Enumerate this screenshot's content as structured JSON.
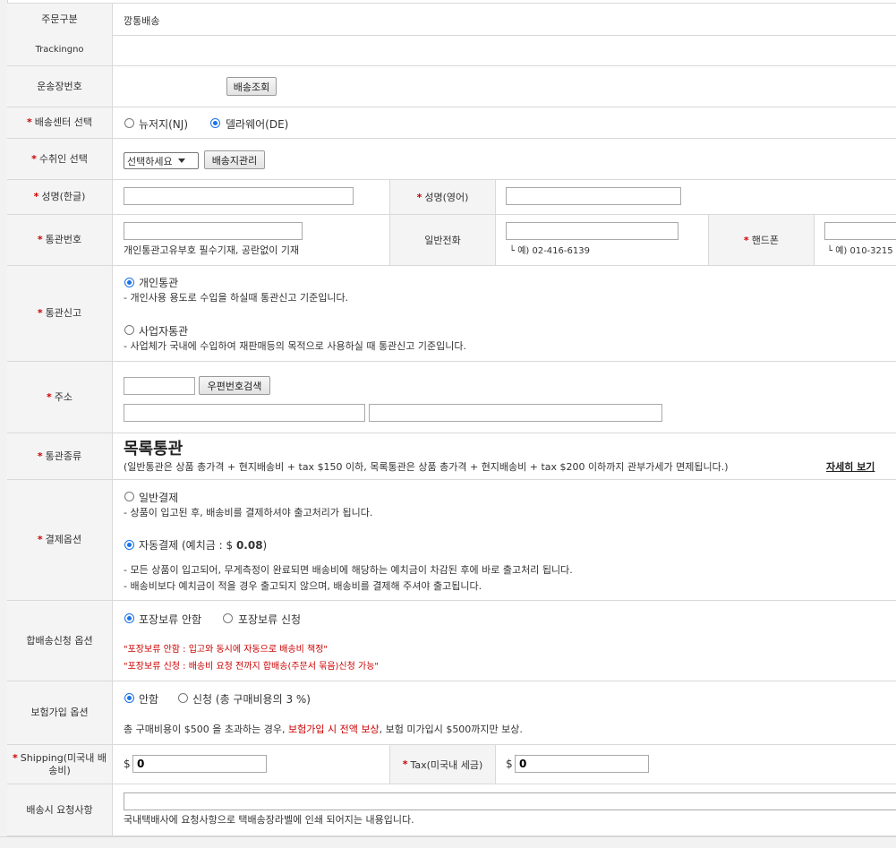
{
  "order_type": {
    "label": "주문구분",
    "value": "깡통배송"
  },
  "tracking": {
    "label": "Trackingno"
  },
  "waybill": {
    "label": "운송장번호",
    "button": "배송조회"
  },
  "center": {
    "label": "배송센터 선택",
    "options": [
      "뉴저지(NJ)",
      "델라웨어(DE)"
    ],
    "selected": 1
  },
  "recipient": {
    "label": "수취인 선택",
    "select_value": "선택하세요",
    "button": "배송지관리"
  },
  "name": {
    "label_kr": "성명(한글)",
    "label_en": "성명(영어)"
  },
  "customs_no": {
    "label": "통관번호",
    "hint": "개인통관고유부호 필수기재, 공란없이 기재",
    "phone_label": "일반전화",
    "phone_hint": "└ 예) 02-416-6139",
    "mobile_label": "핸드폰",
    "mobile_hint": "└ 예) 010-3215"
  },
  "customs_report": {
    "label": "통관신고",
    "opt1": "개인통관",
    "opt1_desc": "- 개인사용 용도로 수입을 하실때 통관신고 기준입니다.",
    "opt2": "사업자통관",
    "opt2_desc": "- 사업체가 국내에 수입하여 재판매등의 목적으로 사용하실 때 통관신고 기준입니다."
  },
  "address": {
    "label": "주소",
    "button": "우편번호검색"
  },
  "customs_type": {
    "label": "통관종류",
    "value": "목록통관",
    "desc": "(일반통관은 상품 총가격 + 현지배송비 + tax $150 이하, 목록통관은 상품 총가격 + 현지배송비 + tax  $200 이하까지 관부가세가 면제됩니다.)",
    "link": "자세히 보기"
  },
  "payment": {
    "label": "결제옵션",
    "opt1": "일반결제",
    "opt1_desc": "- 상품이 입고된 후, 배송비를 결제하셔야 출고처리가 됩니다.",
    "opt2": "자동결제",
    "opt2_prefix": "(예치금 : $ ",
    "opt2_amount": "0.08",
    "opt2_suffix": ")",
    "desc1": "- 모든 상품이 입고되어, 무게측정이 완료되면 배송비에 해당하는 예치금이 차감된 후에 바로 출고처리 됩니다.",
    "desc2": "- 배송비보다 예치금이 적을 경우 출고되지 않으며, 배송비를 결제해 주셔야 출고됩니다."
  },
  "combine": {
    "label": "합배송신청 옵션",
    "opt1": "포장보류 안함",
    "opt2": "포장보류 신청",
    "note1": "\"포장보류 안함 : 입고와 동시에 자동으로 배송비 책정\"",
    "note2": "\"포장보류 신청 : 배송비 요청 전까지 합배송(주문서 묶음)신청 가능\""
  },
  "insurance": {
    "label": "보험가입 옵션",
    "opt1": "안함",
    "opt2": "신청 (총 구매비용의 3 %)",
    "note_prefix": "총 구매비용이 $500 을 초과하는 경우, ",
    "note_red": "보험가입 시 전액 보상",
    "note_suffix": ", 보험 미가입시 $500까지만 보상."
  },
  "shipping": {
    "label_line1": "Shipping(미국내 배",
    "label_line2": "송비)",
    "currency": "$",
    "value": "0",
    "tax_label": "Tax(미국내 세금)",
    "tax_value": "0"
  },
  "request": {
    "label": "배송시 요청사항",
    "hint": "국내택배사에 요청사항으로 택배송장라벨에 인쇄 되어지는 내용입니다."
  },
  "colors": {
    "accent": "#1a73e8",
    "warning": "#cc0000",
    "label_bg": "#f4f4f4"
  }
}
